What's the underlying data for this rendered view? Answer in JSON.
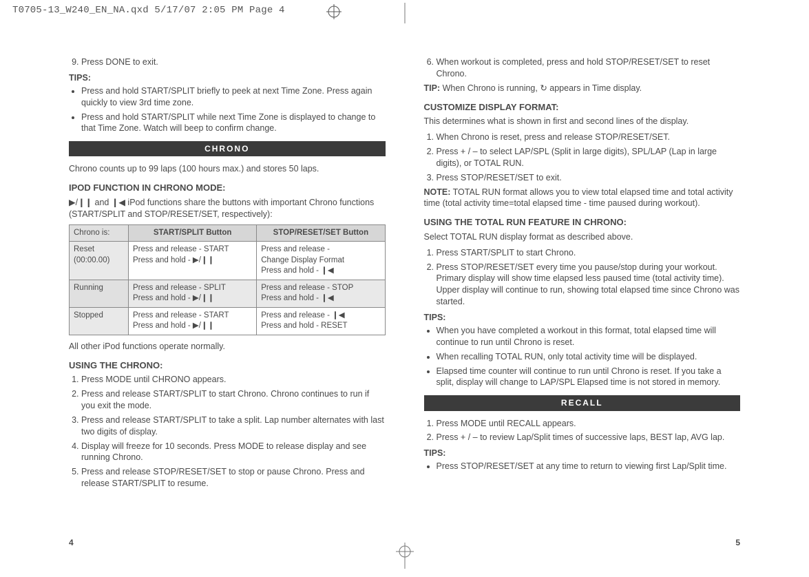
{
  "slug": "T0705-13_W240_EN_NA.qxd  5/17/07  2:05 PM  Page 4",
  "left": {
    "step9": "Press DONE to exit.",
    "tips_hd": "TIPS:",
    "tip1": "Press and hold START/SPLIT briefly to peek at next Time Zone. Press again quickly to view 3rd time zone.",
    "tip2": "Press and hold START/SPLIT while next Time Zone is displayed to change to that Time Zone. Watch will beep to confirm change.",
    "bar_chrono": "CHRONO",
    "chrono_intro": "Chrono counts up to 99 laps (100 hours max.) and stores 50 laps.",
    "ipod_hd": "IPOD FUNCTION IN CHRONO MODE:",
    "ipod_p": " iPod functions share the buttons with important Chrono functions (START/SPLIT and STOP/RESET/SET, respectively):",
    "table": {
      "h_state": "Chrono is:",
      "h_start": "START/SPLIT Button",
      "h_stop": "STOP/RESET/SET Button",
      "r1s": "Reset\n(00:00.00)",
      "r1a": "Press and release - START\nPress and hold - ▶/❙❙",
      "r1b": "Press and release -\nChange Display Format\nPress and hold - ❙◀",
      "r2s": "Running",
      "r2a": "Press and release - SPLIT\nPress and hold - ▶/❙❙",
      "r2b": "Press and release - STOP\nPress and hold - ❙◀",
      "r3s": "Stopped",
      "r3a": "Press and release - START\nPress and hold - ▶/❙❙",
      "r3b": "Press and release - ❙◀\nPress and hold - RESET"
    },
    "all_other": "All other iPod functions operate normally.",
    "using_hd": "USING THE CHRONO:",
    "u1": "Press MODE until CHRONO appears.",
    "u2": "Press and release START/SPLIT to start Chrono. Chrono continues to run if you exit the mode.",
    "u3": "Press and release START/SPLIT to take a split. Lap number alternates with last two digits of display.",
    "u4": "Display will freeze for 10 seconds. Press MODE to release display and see running Chrono.",
    "u5": "Press and release STOP/RESET/SET to stop or pause Chrono. Press and release START/SPLIT to resume.",
    "pagenum": "4"
  },
  "right": {
    "u6": "When workout is completed, press and hold STOP/RESET/SET to reset Chrono.",
    "tip_hd": "TIP:",
    "tip_txt": " When Chrono is running, ↻ appears in Time display.",
    "cust_hd": "CUSTOMIZE DISPLAY FORMAT:",
    "cust_intro": "This determines what is shown in first and second lines of the display.",
    "c1": "When Chrono is reset, press and release STOP/RESET/SET.",
    "c2": "Press + / – to select LAP/SPL (Split in large digits), SPL/LAP (Lap in large digits), or TOTAL RUN.",
    "c3": "Press STOP/RESET/SET to exit.",
    "note_hd": "NOTE:",
    "note_txt": " TOTAL RUN format allows you to view total elapsed time and total activity time (total activity time=total elapsed time - time paused during workout).",
    "using_total_hd": "USING THE TOTAL RUN FEATURE IN CHRONO:",
    "sel_total": "Select TOTAL RUN display format as described above.",
    "t1": "Press START/SPLIT to start Chrono.",
    "t2": "Press STOP/RESET/SET every time you pause/stop during your workout. Primary display will show time elapsed less paused time (total activity time). Upper display will continue to run, showing total elapsed time since Chrono was started.",
    "tips_hd": "TIPS:",
    "tp1": "When you have completed a workout in this format, total elapsed time will continue to run until Chrono is reset.",
    "tp2": "When recalling TOTAL RUN, only total activity time will be displayed.",
    "tp3": "Elapsed time counter will continue to run until Chrono is reset. If you take a split, display will change to LAP/SPL Elapsed time is not stored in memory.",
    "bar_recall": "RECALL",
    "r1": "Press MODE until RECALL appears.",
    "r2": "Press + / – to review Lap/Split times of successive laps, BEST lap, AVG lap.",
    "rtips_hd": "TIPS:",
    "rtp1": "Press STOP/RESET/SET at any time to return to viewing first Lap/Split time.",
    "pagenum": "5"
  }
}
